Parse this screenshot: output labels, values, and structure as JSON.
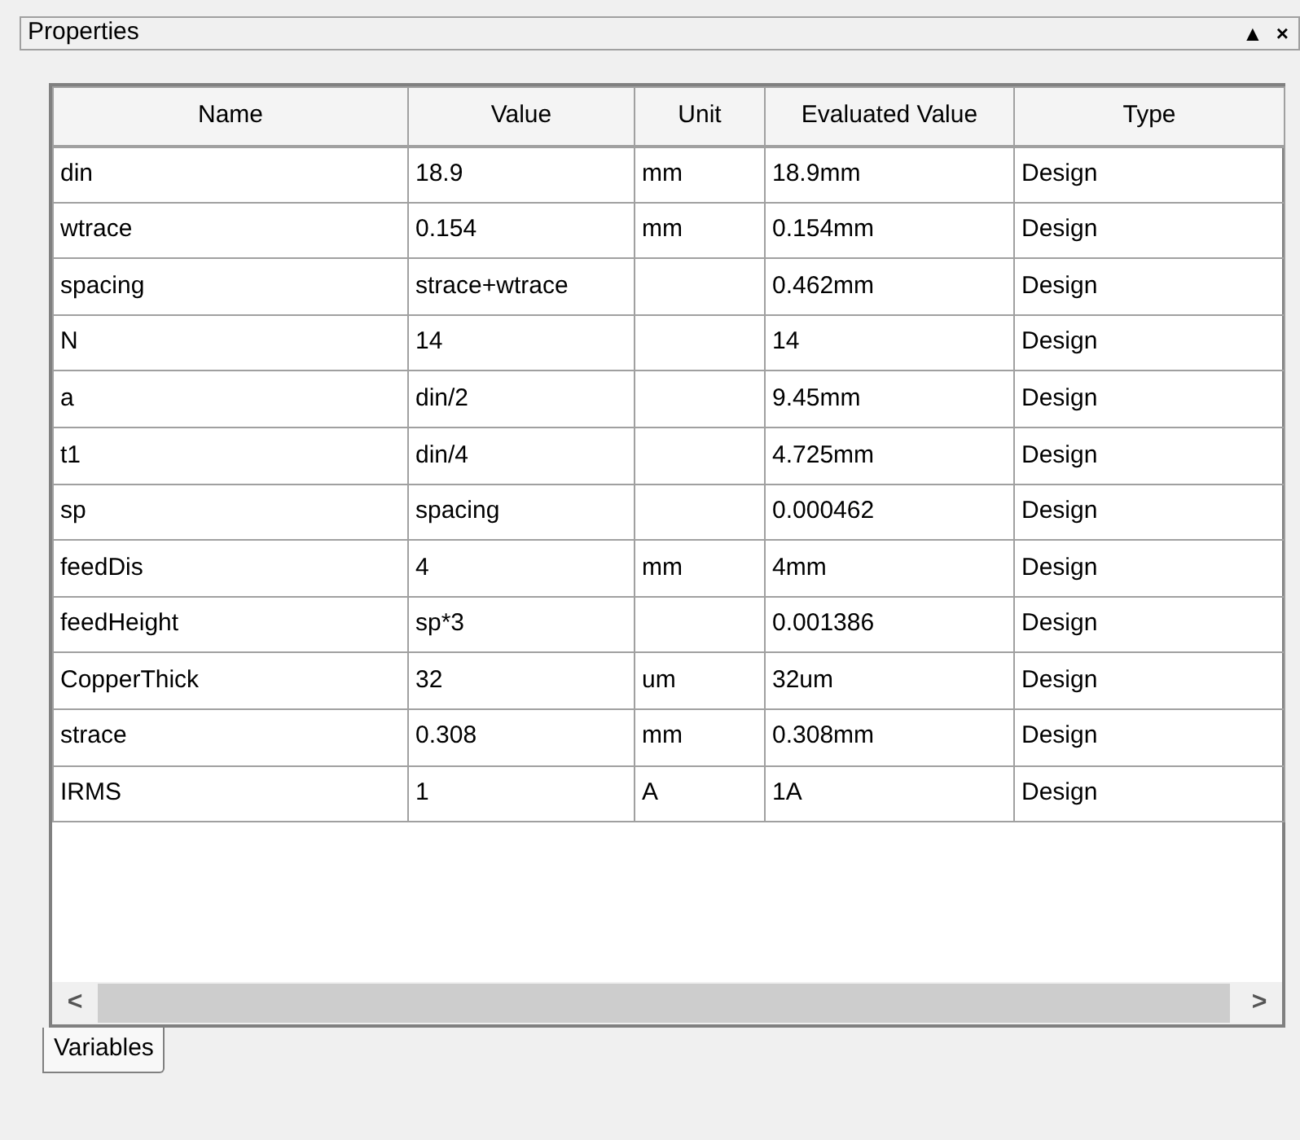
{
  "panel": {
    "title": "Properties",
    "pin_button": "▲",
    "close_button": "×"
  },
  "table": {
    "columns": [
      "Name",
      "Value",
      "Unit",
      "Evaluated Value",
      "Type"
    ],
    "rows": [
      [
        "din",
        "18.9",
        "mm",
        "18.9mm",
        "Design"
      ],
      [
        "wtrace",
        "0.154",
        "mm",
        "0.154mm",
        "Design"
      ],
      [
        "spacing",
        "strace+wtrace",
        "",
        "0.462mm",
        "Design"
      ],
      [
        "N",
        "14",
        "",
        "14",
        "Design"
      ],
      [
        "a",
        "din/2",
        "",
        "9.45mm",
        "Design"
      ],
      [
        "t1",
        "din/4",
        "",
        "4.725mm",
        "Design"
      ],
      [
        "sp",
        "spacing",
        "",
        "0.000462",
        "Design"
      ],
      [
        "feedDis",
        "4",
        "mm",
        "4mm",
        "Design"
      ],
      [
        "feedHeight",
        "sp*3",
        "",
        "0.001386",
        "Design"
      ],
      [
        "CopperThick",
        "32",
        "um",
        "32um",
        "Design"
      ],
      [
        "strace",
        "0.308",
        "mm",
        "0.308mm",
        "Design"
      ],
      [
        "IRMS",
        "1",
        "A",
        "1A",
        "Design"
      ]
    ]
  },
  "scroll_buttons": {
    "left": "<",
    "right": ">"
  },
  "tabs": [
    {
      "label": "Variables",
      "selected": true
    }
  ]
}
